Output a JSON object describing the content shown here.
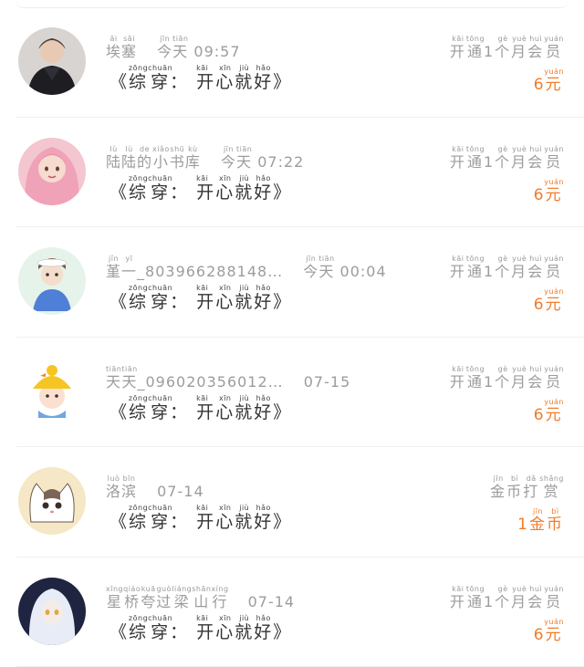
{
  "records": [
    {
      "name_segments": [
        {
          "t": "埃",
          "p": "āi"
        },
        {
          "t": "塞",
          "p": "sāi"
        }
      ],
      "time_segments": [
        {
          "t": "今",
          "p": "jīn"
        },
        {
          "t": "天",
          "p": "tiān"
        },
        {
          "t": " 09:57",
          "p": ""
        }
      ],
      "message_segments": [
        {
          "t": "《",
          "p": ""
        },
        {
          "t": "综",
          "p": "zōng"
        },
        {
          "t": "穿",
          "p": "chuān"
        },
        {
          "t": "：",
          "p": ""
        },
        {
          "t": " 开",
          "p": "kāi"
        },
        {
          "t": "心",
          "p": "xīn"
        },
        {
          "t": "就",
          "p": "jiù"
        },
        {
          "t": "好",
          "p": "hǎo"
        },
        {
          "t": "》",
          "p": ""
        }
      ],
      "action_segments": [
        {
          "t": "开",
          "p": "kāi"
        },
        {
          "t": "通",
          "p": "tōng"
        },
        {
          "t": "1",
          "p": ""
        },
        {
          "t": "个",
          "p": "gè"
        },
        {
          "t": "月",
          "p": "yuè"
        },
        {
          "t": "会",
          "p": "huì"
        },
        {
          "t": "员",
          "p": "yuán"
        }
      ],
      "amount_segments": [
        {
          "t": "6",
          "p": ""
        },
        {
          "t": "元",
          "p": "yuán"
        }
      ],
      "avatar": "avatar-man-black-jacket"
    },
    {
      "name_segments": [
        {
          "t": "陆",
          "p": "lù"
        },
        {
          "t": "陆",
          "p": "lù"
        },
        {
          "t": "的",
          "p": "de"
        },
        {
          "t": "小",
          "p": "xiǎo"
        },
        {
          "t": "书",
          "p": "shū"
        },
        {
          "t": "库",
          "p": "kù"
        }
      ],
      "time_segments": [
        {
          "t": "今",
          "p": "jīn"
        },
        {
          "t": "天",
          "p": "tiān"
        },
        {
          "t": " 07:22",
          "p": ""
        }
      ],
      "message_segments": [
        {
          "t": "《",
          "p": ""
        },
        {
          "t": "综",
          "p": "zōng"
        },
        {
          "t": "穿",
          "p": "chuān"
        },
        {
          "t": "：",
          "p": ""
        },
        {
          "t": " 开",
          "p": "kāi"
        },
        {
          "t": "心",
          "p": "xīn"
        },
        {
          "t": "就",
          "p": "jiù"
        },
        {
          "t": "好",
          "p": "hǎo"
        },
        {
          "t": "》",
          "p": ""
        }
      ],
      "action_segments": [
        {
          "t": "开",
          "p": "kāi"
        },
        {
          "t": "通",
          "p": "tōng"
        },
        {
          "t": "1",
          "p": ""
        },
        {
          "t": "个",
          "p": "gè"
        },
        {
          "t": "月",
          "p": "yuè"
        },
        {
          "t": "会",
          "p": "huì"
        },
        {
          "t": "员",
          "p": "yuán"
        }
      ],
      "amount_segments": [
        {
          "t": "6",
          "p": ""
        },
        {
          "t": "元",
          "p": "yuán"
        }
      ],
      "avatar": "avatar-pink-hair-girl"
    },
    {
      "name_segments": [
        {
          "t": "堇",
          "p": "jǐn"
        },
        {
          "t": "一",
          "p": "yī"
        },
        {
          "t": "_803966288148…",
          "p": ""
        }
      ],
      "time_segments": [
        {
          "t": "今",
          "p": "jīn"
        },
        {
          "t": "天",
          "p": "tiān"
        },
        {
          "t": " 00:04",
          "p": ""
        }
      ],
      "message_segments": [
        {
          "t": "《",
          "p": ""
        },
        {
          "t": "综",
          "p": "zōng"
        },
        {
          "t": "穿",
          "p": "chuān"
        },
        {
          "t": "：",
          "p": ""
        },
        {
          "t": " 开",
          "p": "kāi"
        },
        {
          "t": "心",
          "p": "xīn"
        },
        {
          "t": "就",
          "p": "jiù"
        },
        {
          "t": "好",
          "p": "hǎo"
        },
        {
          "t": "》",
          "p": ""
        }
      ],
      "action_segments": [
        {
          "t": "开",
          "p": "kāi"
        },
        {
          "t": "通",
          "p": "tōng"
        },
        {
          "t": "1",
          "p": ""
        },
        {
          "t": "个",
          "p": "gè"
        },
        {
          "t": "月",
          "p": "yuè"
        },
        {
          "t": "会",
          "p": "huì"
        },
        {
          "t": "员",
          "p": "yuán"
        }
      ],
      "amount_segments": [
        {
          "t": "6",
          "p": ""
        },
        {
          "t": "元",
          "p": "yuán"
        }
      ],
      "avatar": "avatar-cartoon-blue-dress"
    },
    {
      "name_segments": [
        {
          "t": "天",
          "p": "tiān"
        },
        {
          "t": "天",
          "p": "tiān"
        },
        {
          "t": "_096020356012…",
          "p": ""
        }
      ],
      "time_segments": [
        {
          "t": "07-15",
          "p": ""
        }
      ],
      "message_segments": [
        {
          "t": "《",
          "p": ""
        },
        {
          "t": "综",
          "p": "zōng"
        },
        {
          "t": "穿",
          "p": "chuān"
        },
        {
          "t": "：",
          "p": ""
        },
        {
          "t": " 开",
          "p": "kāi"
        },
        {
          "t": "心",
          "p": "xīn"
        },
        {
          "t": "就",
          "p": "jiù"
        },
        {
          "t": "好",
          "p": "hǎo"
        },
        {
          "t": "》",
          "p": ""
        }
      ],
      "action_segments": [
        {
          "t": "开",
          "p": "kāi"
        },
        {
          "t": "通",
          "p": "tōng"
        },
        {
          "t": "1",
          "p": ""
        },
        {
          "t": "个",
          "p": "gè"
        },
        {
          "t": "月",
          "p": "yuè"
        },
        {
          "t": "会",
          "p": "huì"
        },
        {
          "t": "员",
          "p": "yuán"
        }
      ],
      "amount_segments": [
        {
          "t": "6",
          "p": ""
        },
        {
          "t": "元",
          "p": "yuán"
        }
      ],
      "avatar": "avatar-kid-duck-hat"
    },
    {
      "name_segments": [
        {
          "t": "洛",
          "p": "luò"
        },
        {
          "t": "滨",
          "p": "bīn"
        }
      ],
      "time_segments": [
        {
          "t": "07-14",
          "p": ""
        }
      ],
      "message_segments": [
        {
          "t": "《",
          "p": ""
        },
        {
          "t": "综",
          "p": "zōng"
        },
        {
          "t": "穿",
          "p": "chuān"
        },
        {
          "t": "：",
          "p": ""
        },
        {
          "t": " 开",
          "p": "kāi"
        },
        {
          "t": "心",
          "p": "xīn"
        },
        {
          "t": "就",
          "p": "jiù"
        },
        {
          "t": "好",
          "p": "hǎo"
        },
        {
          "t": "》",
          "p": ""
        }
      ],
      "action_segments": [
        {
          "t": "金",
          "p": "jīn"
        },
        {
          "t": "币",
          "p": "bì"
        },
        {
          "t": "打",
          "p": "dǎ"
        },
        {
          "t": "赏",
          "p": "shǎng"
        }
      ],
      "amount_segments": [
        {
          "t": "1",
          "p": ""
        },
        {
          "t": "金",
          "p": "jīn"
        },
        {
          "t": "币",
          "p": "bì"
        }
      ],
      "avatar": "avatar-cartoon-cat"
    },
    {
      "name_segments": [
        {
          "t": "星",
          "p": "xīng"
        },
        {
          "t": "桥",
          "p": "qiáo"
        },
        {
          "t": "夸",
          "p": "kuā"
        },
        {
          "t": "过",
          "p": "guò"
        },
        {
          "t": "梁",
          "p": "liáng"
        },
        {
          "t": "山",
          "p": "shān"
        },
        {
          "t": "行",
          "p": "xíng"
        }
      ],
      "time_segments": [
        {
          "t": "07-14",
          "p": ""
        }
      ],
      "message_segments": [
        {
          "t": "《",
          "p": ""
        },
        {
          "t": "综",
          "p": "zōng"
        },
        {
          "t": "穿",
          "p": "chuān"
        },
        {
          "t": "：",
          "p": ""
        },
        {
          "t": " 开",
          "p": "kāi"
        },
        {
          "t": "心",
          "p": "xīn"
        },
        {
          "t": "就",
          "p": "jiù"
        },
        {
          "t": "好",
          "p": "hǎo"
        },
        {
          "t": "》",
          "p": ""
        }
      ],
      "action_segments": [
        {
          "t": "开",
          "p": "kāi"
        },
        {
          "t": "通",
          "p": "tōng"
        },
        {
          "t": "1",
          "p": ""
        },
        {
          "t": "个",
          "p": "gè"
        },
        {
          "t": "月",
          "p": "yuè"
        },
        {
          "t": "会",
          "p": "huì"
        },
        {
          "t": "员",
          "p": "yuán"
        }
      ],
      "amount_segments": [
        {
          "t": "6",
          "p": ""
        },
        {
          "t": "元",
          "p": "yuán"
        }
      ],
      "avatar": "avatar-anime-white-hair"
    }
  ],
  "colors": {
    "accent": "#f07c2a",
    "muted": "#9c9c9c",
    "text": "#333333",
    "divider": "#f0f0f0"
  }
}
